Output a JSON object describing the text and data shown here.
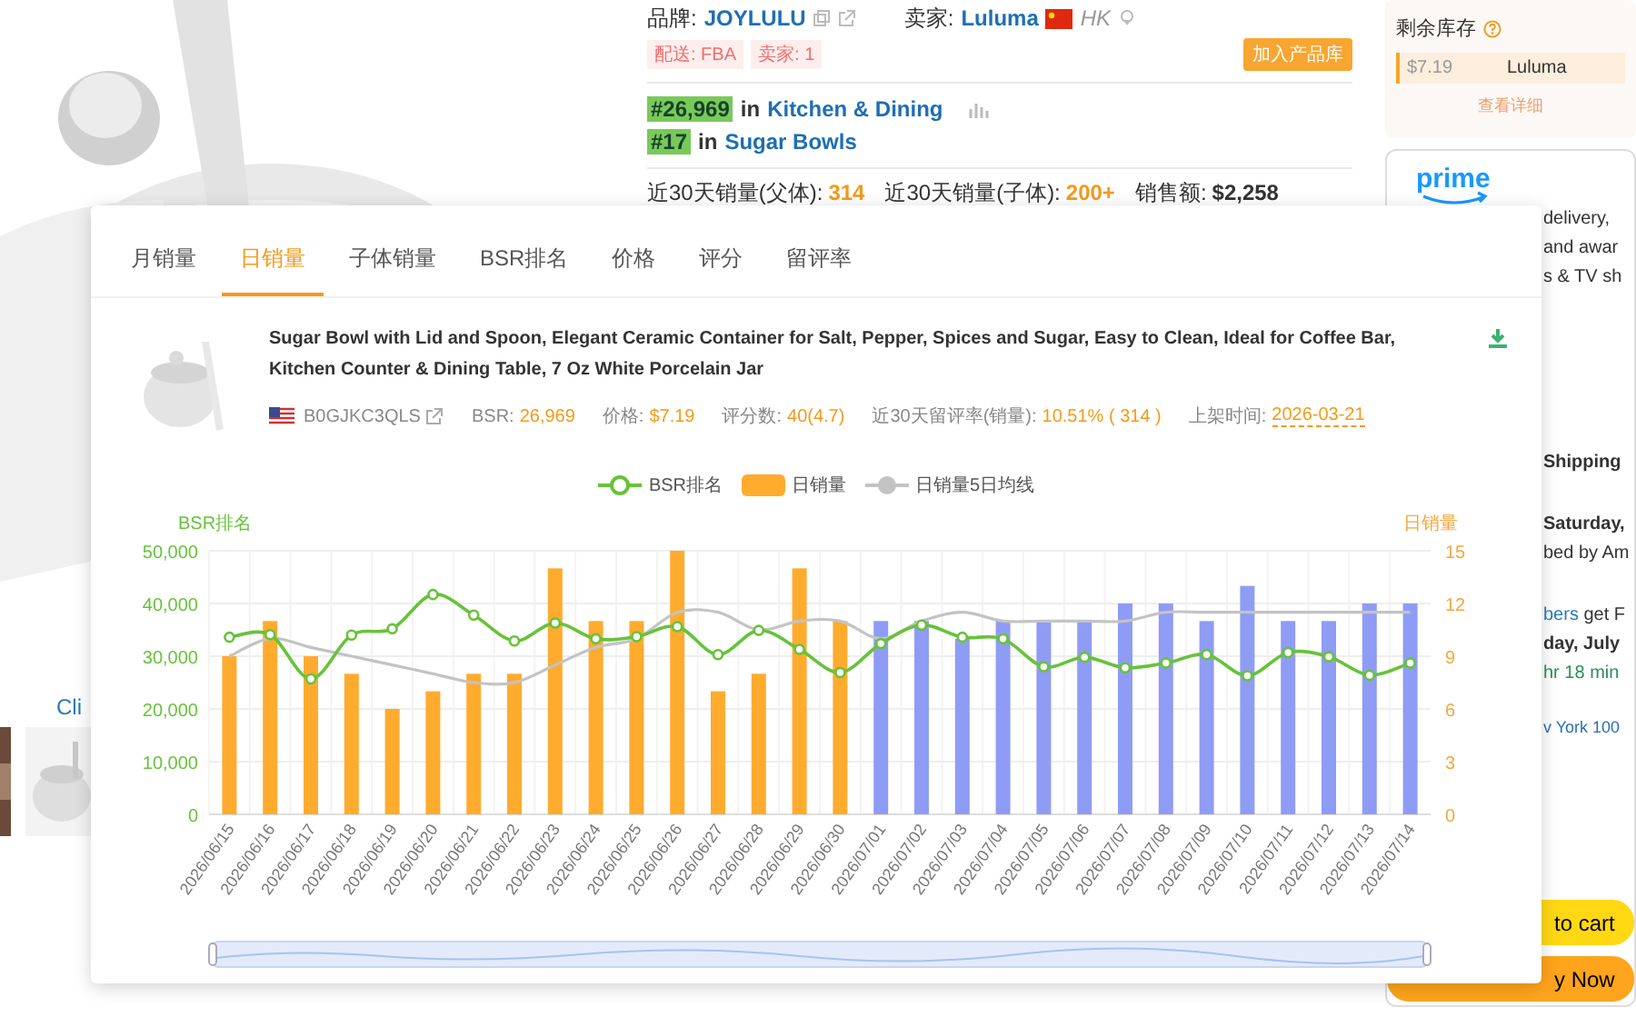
{
  "product_page": {
    "brand_label": "品牌:",
    "brand": "JOYLULU",
    "seller_label": "卖家:",
    "seller": "Luluma",
    "seller_country": "HK",
    "tags": [
      "配送: FBA",
      "卖家: 1"
    ],
    "add_button": "加入产品库",
    "ranks": [
      {
        "rank": "#26,969",
        "in": "in",
        "category": "Kitchen & Dining",
        "chart_icon": true
      },
      {
        "rank": "#17",
        "in": "in",
        "category": "Sugar Bowls",
        "chart_icon": false
      }
    ],
    "stats": [
      {
        "label": "近30天销量(父体):",
        "value": "314",
        "kind": "accent"
      },
      {
        "label": "近30天销量(子体):",
        "value": "200+",
        "kind": "accent"
      },
      {
        "label": "销售额:",
        "value": "$2,258",
        "kind": "plain"
      }
    ],
    "image_link": "Cli"
  },
  "stock_panel": {
    "title": "剩余库存",
    "offers": [
      {
        "price": "$7.19",
        "seller": "Luluma"
      }
    ],
    "details_link": "查看详细"
  },
  "delivery_panel": {
    "logo": "prime",
    "lines": [
      {
        "kind": "text",
        "text": "delivery,"
      },
      {
        "kind": "text",
        "text": "and awar"
      },
      {
        "kind": "text",
        "text": "s & TV sh"
      },
      {
        "kind": "bold",
        "text": "Shipping"
      },
      {
        "kind": "bold",
        "text": "Saturday,"
      },
      {
        "kind": "text",
        "text": "bed by Am"
      },
      {
        "kind": "link",
        "text": "bers",
        "rest": "get F"
      },
      {
        "kind": "bold",
        "text": "day, July"
      },
      {
        "kind": "green",
        "text": "hr 18 min"
      },
      {
        "kind": "location",
        "text": "v York 100"
      }
    ],
    "buttons": [
      {
        "kind": "cart",
        "label": "to cart"
      },
      {
        "kind": "buy",
        "label": "y Now"
      }
    ]
  },
  "popup": {
    "tabs": [
      {
        "label": "月销量",
        "selected": false
      },
      {
        "label": "日销量",
        "selected": true
      },
      {
        "label": "子体销量",
        "selected": false
      },
      {
        "label": "BSR排名",
        "selected": false
      },
      {
        "label": "价格",
        "selected": false
      },
      {
        "label": "评分",
        "selected": false
      },
      {
        "label": "留评率",
        "selected": false
      }
    ],
    "product": {
      "title": "Sugar Bowl with Lid and Spoon, Elegant Ceramic Container for Salt, Pepper, Spices and Sugar, Easy to Clean, Ideal for Coffee Bar, Kitchen Counter & Dining Table, 7 Oz White Porcelain Jar",
      "asin": "B0GJKC3QLS",
      "meta": [
        {
          "label": "BSR:",
          "value": "26,969",
          "kind": "plain"
        },
        {
          "label": "价格:",
          "value": "$7.19",
          "kind": "plain"
        },
        {
          "label": "评分数:",
          "value": "40(4.7)",
          "kind": "plain"
        },
        {
          "label": "近30天留评率(销量):",
          "value": "10.51% ( 314 )",
          "kind": "plain"
        },
        {
          "label": "上架时间:",
          "value": "2026-03-21",
          "kind": "dashed"
        }
      ]
    },
    "chart_data": {
      "type": "bar",
      "ylabel": "BSR排名",
      "y2label": "日销量",
      "categories": [
        "2026/06/15",
        "2026/06/16",
        "2026/06/17",
        "2026/06/18",
        "2026/06/19",
        "2026/06/20",
        "2026/06/21",
        "2026/06/22",
        "2026/06/23",
        "2026/06/24",
        "2026/06/25",
        "2026/06/26",
        "2026/06/27",
        "2026/06/28",
        "2026/06/29",
        "2026/06/30",
        "2026/07/01",
        "2026/07/02",
        "2026/07/03",
        "2026/07/04",
        "2026/07/05",
        "2026/07/06",
        "2026/07/07",
        "2026/07/08",
        "2026/07/09",
        "2026/07/10",
        "2026/07/11",
        "2026/07/12",
        "2026/07/13",
        "2026/07/14"
      ],
      "series": [
        {
          "name": "BSR排名",
          "type": "line",
          "color": "#67c23a",
          "marker": true,
          "values": [
            33600,
            34100,
            25700,
            34000,
            35200,
            41700,
            37800,
            32900,
            36300,
            33300,
            33700,
            35600,
            30300,
            34900,
            31300,
            26900,
            32400,
            35900,
            33600,
            33300,
            28000,
            29800,
            27800,
            28700,
            30300,
            26300,
            30700,
            29900,
            26400,
            28700
          ]
        },
        {
          "name": "日销量",
          "type": "bar",
          "color": "#ffab2e",
          "axis": "y2",
          "colors": [
            "#ffab2e",
            "#ffab2e",
            "#ffab2e",
            "#ffab2e",
            "#ffab2e",
            "#ffab2e",
            "#ffab2e",
            "#ffab2e",
            "#ffab2e",
            "#ffab2e",
            "#ffab2e",
            "#ffab2e",
            "#ffab2e",
            "#ffab2e",
            "#ffab2e",
            "#ffab2e",
            "#8f9cf5",
            "#8f9cf5",
            "#8f9cf5",
            "#8f9cf5",
            "#8f9cf5",
            "#8f9cf5",
            "#8f9cf5",
            "#8f9cf5",
            "#8f9cf5",
            "#8f9cf5",
            "#8f9cf5",
            "#8f9cf5",
            "#8f9cf5",
            "#8f9cf5"
          ],
          "values": [
            9,
            11,
            9,
            8,
            6,
            7,
            8,
            8,
            14,
            11,
            11,
            15,
            7,
            8,
            14,
            11,
            11,
            11,
            10,
            11,
            11,
            11,
            12,
            12,
            11,
            13,
            11,
            11,
            12,
            12
          ]
        },
        {
          "name": "日销量5日均线",
          "type": "line",
          "color": "#c3c3c3",
          "axis": "y2",
          "values": [
            9,
            10,
            9.5,
            9,
            8.5,
            8,
            7.5,
            7.5,
            8.5,
            9.5,
            10,
            11.5,
            11.5,
            10.5,
            11,
            11,
            10,
            11,
            11.5,
            11,
            11,
            11,
            11,
            11.5,
            11.5,
            11.5,
            11.5,
            11.5,
            11.5,
            11.5
          ]
        }
      ],
      "grid": true,
      "ylim": [
        0,
        50000
      ],
      "yticks": [
        {
          "value": 0,
          "label": "0"
        },
        {
          "value": 10000,
          "label": "10,000"
        },
        {
          "value": 20000,
          "label": "20,000"
        },
        {
          "value": 30000,
          "label": "30,000"
        },
        {
          "value": 40000,
          "label": "40,000"
        },
        {
          "value": 50000,
          "label": "50,000"
        }
      ],
      "y2lim": [
        0,
        15
      ],
      "y2ticks": [
        0,
        3,
        6,
        9,
        12,
        15
      ]
    }
  }
}
